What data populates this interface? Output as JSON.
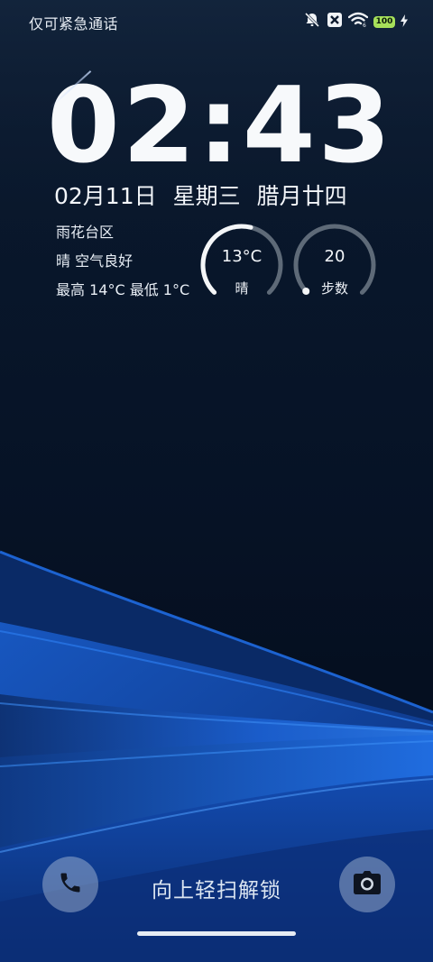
{
  "status_bar": {
    "carrier_text": "仅可紧急通话",
    "icons": [
      "mute-bell-icon",
      "no-sim-icon",
      "wifi-icon",
      "battery-icon",
      "charging-icon"
    ],
    "battery_level": "100",
    "battery_color": "#a6e05a"
  },
  "clock": {
    "time": "02:43"
  },
  "date": {
    "day": "02月11日",
    "weekday": "星期三",
    "lunar": "腊月廿四"
  },
  "weather": {
    "location": "雨花台区",
    "condition_line": "晴  空气良好",
    "high_low": "最高 14°C  最低 1°C"
  },
  "temperature_gauge": {
    "value": "13°C",
    "label": "晴",
    "fill": 0.55
  },
  "steps_gauge": {
    "value": "20",
    "label": "步数",
    "fill": 0.01
  },
  "bottom": {
    "unlock_hint": "向上轻扫解锁",
    "left_icon": "phone-icon",
    "right_icon": "camera-icon"
  },
  "colors": {
    "wave_bright": "#1d66d6",
    "wave_mid": "#1753b8",
    "background_dark": "#061225"
  }
}
